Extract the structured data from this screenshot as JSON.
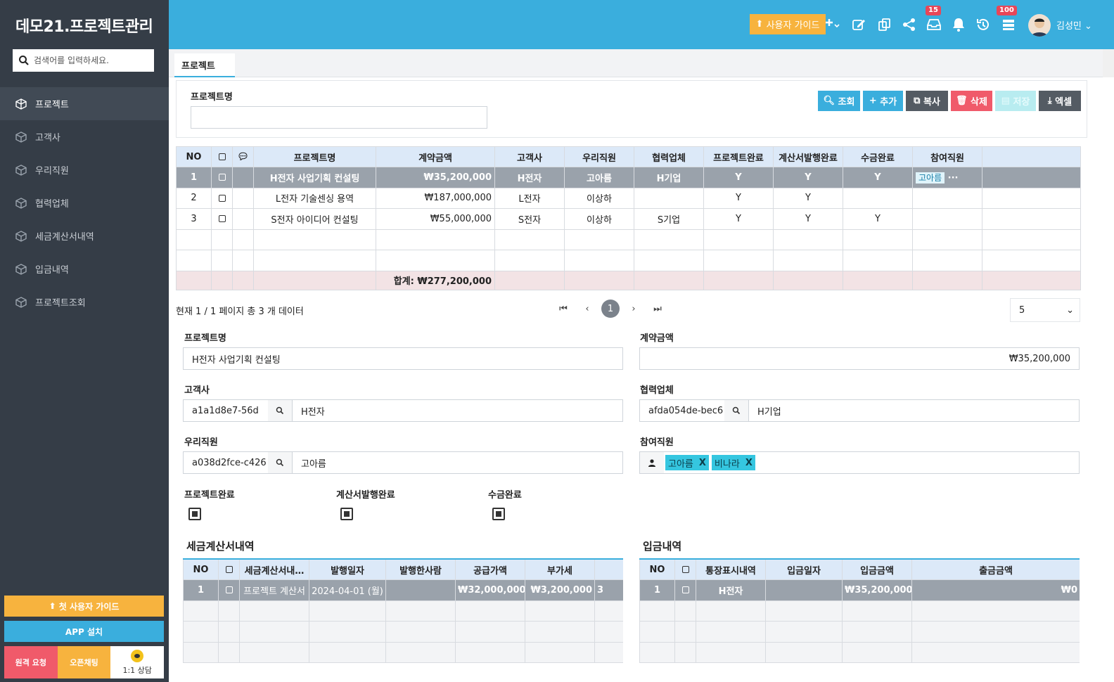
{
  "app": {
    "title": "데모21.프로젝트관리"
  },
  "sidebar": {
    "search_placeholder": "검색어를 입력하세요.",
    "items": [
      {
        "label": "프로젝트"
      },
      {
        "label": "고객사"
      },
      {
        "label": "우리직원"
      },
      {
        "label": "협력업체"
      },
      {
        "label": "세금계산서내역"
      },
      {
        "label": "입금내역"
      },
      {
        "label": "프로젝트조회"
      }
    ],
    "first_guide": "첫 사용자 가이드",
    "app_install": "APP 설치",
    "remote": "원격 요청",
    "open_chat": "오픈채팅",
    "consult": "1:1 상담"
  },
  "header": {
    "guide": "사용자 가이드",
    "badge_inbox": "15",
    "badge_list": "100",
    "user": "김성민"
  },
  "tab": {
    "label": "프로젝트"
  },
  "search": {
    "label": "프로젝트명",
    "value": ""
  },
  "toolbar": {
    "query": "조회",
    "add": "추가",
    "copy": "복사",
    "delete": "삭제",
    "save": "저장",
    "excel": "엑셀"
  },
  "colors": {
    "accent": "#3aaedd",
    "warning": "#f7b33e",
    "danger": "#f05a6a",
    "sidebar": "#353d47"
  },
  "grid": {
    "headers": [
      "NO",
      "",
      "",
      "프로젝트명",
      "계약금액",
      "고객사",
      "우리직원",
      "협력업체",
      "프로젝트완료",
      "계산서발행완료",
      "수금완료",
      "참여직원",
      ""
    ],
    "rows": [
      {
        "no": "1",
        "name": "H전자 사업기획 컨설팅",
        "amount": "₩35,200,000",
        "client": "H전자",
        "staff": "고아름",
        "partner": "H기업",
        "done": "Y",
        "invoice": "Y",
        "paid": "Y",
        "members": "고아름",
        "more": "···"
      },
      {
        "no": "2",
        "name": "L전자 기술센싱 용역",
        "amount": "₩187,000,000",
        "client": "L전자",
        "staff": "이상하",
        "partner": "",
        "done": "Y",
        "invoice": "Y",
        "paid": "",
        "members": "",
        "more": ""
      },
      {
        "no": "3",
        "name": "S전자 아이디어 컨설팅",
        "amount": "₩55,000,000",
        "client": "S전자",
        "staff": "이상하",
        "partner": "S기업",
        "done": "Y",
        "invoice": "Y",
        "paid": "Y",
        "members": "",
        "more": ""
      }
    ],
    "total": "합계: ₩277,200,000"
  },
  "pagination": {
    "info": "현재 1 / 1 페이지 총 3 개 데이터",
    "current": "1",
    "page_size": "5"
  },
  "form": {
    "name_label": "프로젝트명",
    "name_value": "H전자 사업기획 컨설팅",
    "amount_label": "계약금액",
    "amount_value": "₩35,200,000",
    "client_label": "고객사",
    "client_id": "a1a1d8e7-56d",
    "client_name": "H전자",
    "partner_label": "협력업체",
    "partner_id": "afda054de-bec6",
    "partner_name": "H기업",
    "staff_label": "우리직원",
    "staff_id": "a038d2fce-c426",
    "staff_name": "고아름",
    "members_label": "참여직원",
    "members": [
      "고아름",
      "비나라"
    ],
    "tag_remove": "X",
    "done_label": "프로젝트완료",
    "invoice_label": "계산서발행완료",
    "paid_label": "수금완료"
  },
  "tax": {
    "title": "세금계산서내역",
    "headers": [
      "NO",
      "",
      "세금계산서내…",
      "발행일자",
      "발행한사람",
      "공급가액",
      "부가세",
      ""
    ],
    "row": {
      "no": "1",
      "name": "프로젝트 계산서",
      "date": "2024-04-01 (월)",
      "issuer": "",
      "supply": "₩32,000,000",
      "vat": "₩3,200,000",
      "extra": "3"
    }
  },
  "deposit": {
    "title": "입금내역",
    "headers": [
      "NO",
      "",
      "통장표시내역",
      "입금일자",
      "입금금액",
      "출금금액"
    ],
    "row": {
      "no": "1",
      "memo": "H전자",
      "date": "",
      "in": "₩35,200,000",
      "out": "₩0"
    }
  }
}
